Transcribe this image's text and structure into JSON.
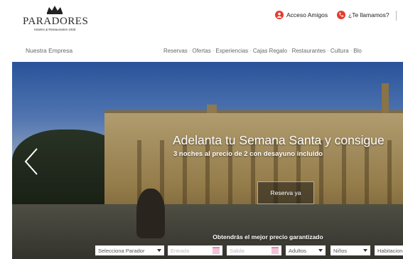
{
  "header": {
    "logo_brand": "PARADORES",
    "logo_tagline": "Hoteles & Restaurantes 1928",
    "acceso_label": "Acceso Amigos",
    "llamamos_label": "¿Te llamamos?"
  },
  "nav": {
    "left": "Nuestra Empresa",
    "items": [
      "Reservas",
      "Ofertas",
      "Experiencias",
      "Cajas Regalo",
      "Restaurantes",
      "Cultura",
      "Blo"
    ]
  },
  "hero": {
    "headline": "Adelanta tu Semana Santa y consigue",
    "subheadline": "3 noches al precio de 2 con desayuno incluido",
    "cta": "Reserva ya",
    "price_note": "Obtendrás el mejor precio garantizado"
  },
  "search_form": {
    "parador": "Selecciona Parador",
    "entrada": "Entrada",
    "salida": "Salida",
    "adultos": "Adultos",
    "ninos": "Niños",
    "habitaciones": "Habitacion"
  },
  "colors": {
    "accent_red": "#e53c2e"
  }
}
